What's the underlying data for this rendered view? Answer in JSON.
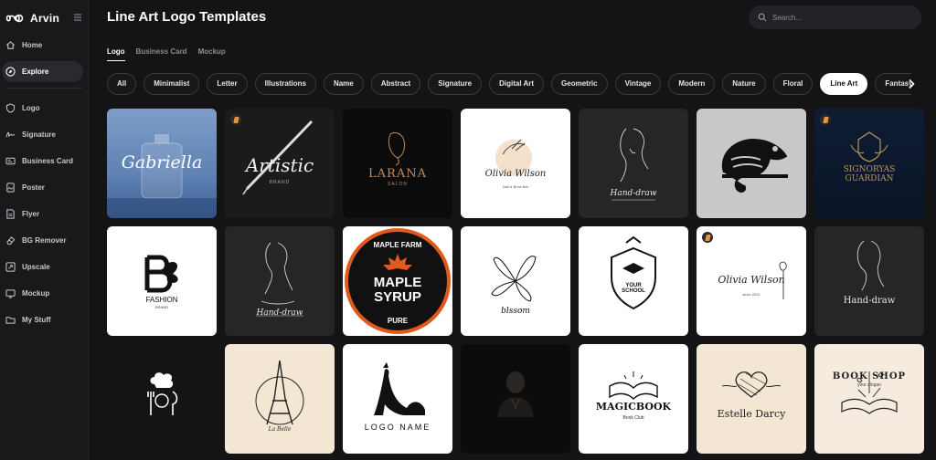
{
  "app": {
    "name": "Arvin"
  },
  "sidebar": {
    "items": [
      {
        "label": "Home",
        "icon": "home-icon"
      },
      {
        "label": "Explore",
        "icon": "compass-icon",
        "active": true
      },
      {
        "label": "Logo",
        "icon": "shield-icon"
      },
      {
        "label": "Signature",
        "icon": "signature-icon"
      },
      {
        "label": "Business Card",
        "icon": "card-icon"
      },
      {
        "label": "Poster",
        "icon": "poster-icon"
      },
      {
        "label": "Flyer",
        "icon": "flyer-icon"
      },
      {
        "label": "BG Remover",
        "icon": "eraser-icon"
      },
      {
        "label": "Upscale",
        "icon": "upscale-icon"
      },
      {
        "label": "Mockup",
        "icon": "mockup-icon"
      },
      {
        "label": "My Stuff",
        "icon": "folder-icon"
      }
    ]
  },
  "header": {
    "title": "Line Art Logo Templates"
  },
  "search": {
    "placeholder": "Search..."
  },
  "tabs": [
    {
      "label": "Logo",
      "active": true
    },
    {
      "label": "Business Card"
    },
    {
      "label": "Mockup"
    }
  ],
  "filters": [
    {
      "label": "All"
    },
    {
      "label": "Minimalist"
    },
    {
      "label": "Letter"
    },
    {
      "label": "Illustrations"
    },
    {
      "label": "Name"
    },
    {
      "label": "Abstract"
    },
    {
      "label": "Signature"
    },
    {
      "label": "Digital Art"
    },
    {
      "label": "Geometric"
    },
    {
      "label": "Vintage"
    },
    {
      "label": "Modern"
    },
    {
      "label": "Nature"
    },
    {
      "label": "Floral"
    },
    {
      "label": "Line Art",
      "active": true
    },
    {
      "label": "Fantasy"
    }
  ],
  "templates": [
    {
      "name": "Gabriella",
      "premium": false
    },
    {
      "name": "Artistic",
      "sub": "BRAND",
      "premium": true
    },
    {
      "name": "LARANA",
      "sub": "SALON",
      "premium": false
    },
    {
      "name": "Olivia Wilson",
      "sub": "Nail & Brow Bar",
      "premium": false
    },
    {
      "name": "Hand-draw",
      "premium": false
    },
    {
      "name": "chameleon",
      "premium": false
    },
    {
      "name": "SIGNORYAS GUARDIAN",
      "premium": true
    },
    {
      "name": "FASHION",
      "sub": "BRAND",
      "premium": false
    },
    {
      "name": "Hand-draw",
      "premium": false
    },
    {
      "name": "MAPLE SYRUP",
      "top": "MAPLE FARM",
      "bottom": "PURE",
      "premium": false
    },
    {
      "name": "blssom",
      "premium": false
    },
    {
      "name": "YOUR SCHOOL",
      "premium": false
    },
    {
      "name": "Olivia Wilson",
      "sub": "since 2021",
      "premium": true
    },
    {
      "name": "Hand-draw",
      "premium": false
    },
    {
      "name": "chef",
      "premium": false
    },
    {
      "name": "La Belle",
      "premium": false
    },
    {
      "name": "LOGO NAME",
      "premium": false
    },
    {
      "name": "gentleman",
      "premium": false
    },
    {
      "name": "MAGICBOOK",
      "sub": "Book Club",
      "premium": false
    },
    {
      "name": "Estelle Darcy",
      "premium": false
    },
    {
      "name": "BOOK SHOP",
      "sub": "your slogan",
      "premium": false
    }
  ],
  "colors": {
    "accent_premium": "#e8943a",
    "maple_orange": "#e05a1c"
  }
}
